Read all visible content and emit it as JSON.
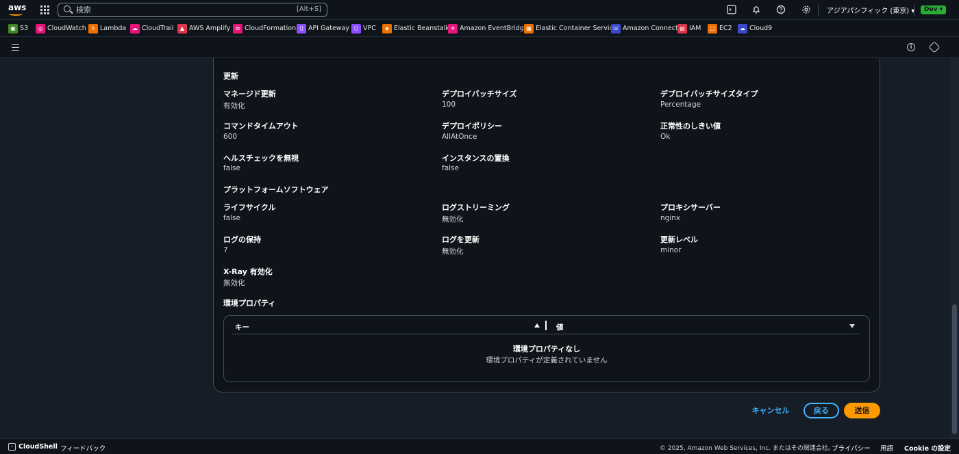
{
  "topnav": {
    "search_placeholder": "検索",
    "search_shortcut": "[Alt+S]",
    "region": "アジアパシフィック (東京) ▾",
    "account_badge": "Dev ▾"
  },
  "favorites": [
    {
      "label": "S3",
      "color": "#3f8624"
    },
    {
      "label": "CloudWatch",
      "color": "#e7157b"
    },
    {
      "label": "Lambda",
      "color": "#ed7100"
    },
    {
      "label": "CloudTrail",
      "color": "#e7157b"
    },
    {
      "label": "AWS Amplify",
      "color": "#dd344c"
    },
    {
      "label": "CloudFormation",
      "color": "#e7157b"
    },
    {
      "label": "API Gateway",
      "color": "#8c4fff"
    },
    {
      "label": "VPC",
      "color": "#8c4fff"
    },
    {
      "label": "Elastic Beanstalk",
      "color": "#ed7100"
    },
    {
      "label": "Amazon EventBridge",
      "color": "#e7157b"
    },
    {
      "label": "Elastic Container Service",
      "color": "#ed7100"
    },
    {
      "label": "Amazon Connect",
      "color": "#3b48cc"
    },
    {
      "label": "IAM",
      "color": "#dd344c"
    },
    {
      "label": "EC2",
      "color": "#ed7100"
    },
    {
      "label": "Cloud9",
      "color": "#3b48cc"
    }
  ],
  "updates": {
    "title": "更新",
    "managed_update_label": "マネージド更新",
    "managed_update_value": "有効化",
    "batch_size_label": "デプロイバッチサイズ",
    "batch_size_value": "100",
    "batch_size_type_label": "デプロイバッチサイズタイプ",
    "batch_size_type_value": "Percentage",
    "command_timeout_label": "コマンドタイムアウト",
    "command_timeout_value": "600",
    "deploy_policy_label": "デプロイポリシー",
    "deploy_policy_value": "AllAtOnce",
    "health_threshold_label": "正常性のしきい値",
    "health_threshold_value": "Ok",
    "ignore_health_label": "ヘルスチェックを無視",
    "ignore_health_value": "false",
    "instance_replace_label": "インスタンスの置換",
    "instance_replace_value": "false"
  },
  "platform": {
    "title": "プラットフォームソフトウェア",
    "lifecycle_label": "ライフサイクル",
    "lifecycle_value": "false",
    "log_streaming_label": "ログストリーミング",
    "log_streaming_value": "無効化",
    "proxy_label": "プロキシサーバー",
    "proxy_value": "nginx",
    "log_retention_label": "ログの保持",
    "log_retention_value": "7",
    "log_update_label": "ログを更新",
    "log_update_value": "無効化",
    "update_level_label": "更新レベル",
    "update_level_value": "minor",
    "xray_label": "X-Ray 有効化",
    "xray_value": "無効化"
  },
  "env_props": {
    "title": "環境プロパティ",
    "col_key": "キー",
    "col_value": "値",
    "empty_title": "環境プロパティなし",
    "empty_desc": "環境プロパティが定義されていません"
  },
  "actions": {
    "cancel": "キャンセル",
    "back": "戻る",
    "submit": "送信"
  },
  "footer": {
    "cloudshell": "CloudShell",
    "feedback": "フィードバック",
    "copyright": "© 2025, Amazon Web Services, Inc. またはその関連会社。",
    "privacy": "プライバシー",
    "terms": "用語",
    "cookie": "Cookie の設定"
  }
}
